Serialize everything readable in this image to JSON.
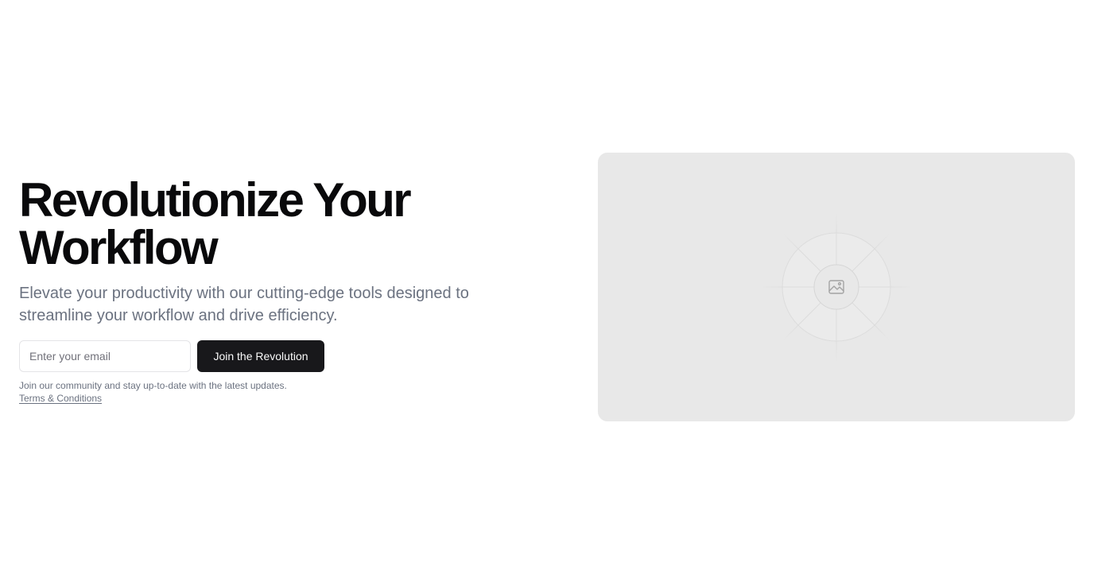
{
  "hero": {
    "title_line1": "Revolutionize Your",
    "title_line2": "Workflow",
    "subtitle": "Elevate your productivity with our cutting-edge tools designed to streamline your workflow and drive efficiency.",
    "email_placeholder": "Enter your email",
    "cta_label": "Join the Revolution",
    "fineprint": "Join our community and stay up-to-date with the latest updates.",
    "terms_label": "Terms & Conditions"
  },
  "media": {
    "icon": "image-placeholder-icon",
    "background_color": "#e8e8e8"
  },
  "colors": {
    "heading": "#09090b",
    "muted_text": "#6b7280",
    "button_bg": "#18181b",
    "button_text": "#fafafa"
  }
}
